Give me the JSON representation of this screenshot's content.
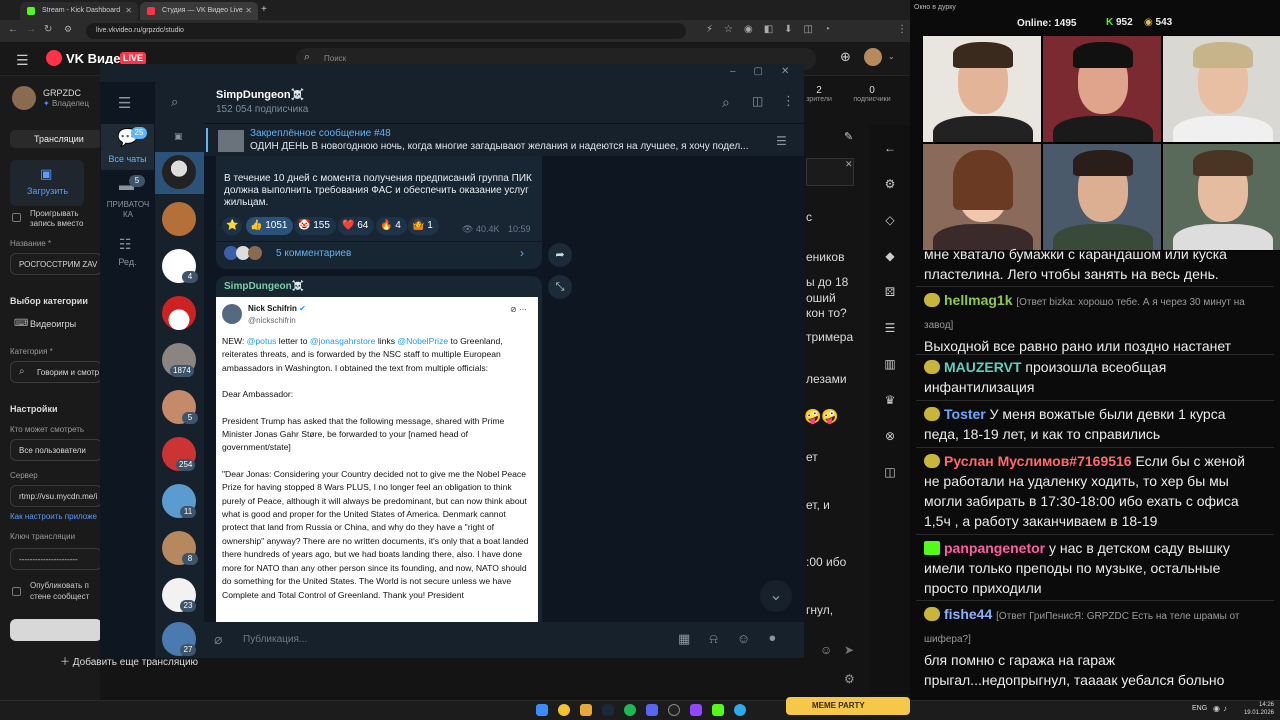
{
  "browser": {
    "tabs": [
      {
        "title": "Stream - Kick Dashboard"
      },
      {
        "title": "Студия — VK Видео Live"
      }
    ],
    "new_tab": "+",
    "url": "live.vkvideo.ru/grpzdc/studio"
  },
  "vk": {
    "logo": "VK Видео",
    "live_badge": "LIVE",
    "search_placeholder": "Поиск",
    "channel_name": "GRPZDC",
    "channel_role": "Владелец",
    "tab_streams": "Трансляции",
    "upload_label": "Загрузить",
    "play_in_cover": "Проигрывать запись вместо обложки",
    "name_label": "Название *",
    "name_value": "РОСГОССТРИМ ZAV",
    "category_title": "Выбор категории",
    "games_label": "Видеоигры",
    "category_label": "Категория *",
    "category_value": "Говорим и смотр",
    "settings_title": "Настройки",
    "who_can_watch_label": "Кто может смотреть",
    "who_can_watch_value": "Все пользователи",
    "server_label": "Сервер",
    "server_value": "rtmp://vsu.mycdn.me/i",
    "how_to_link": "Как настроить приложе",
    "key_label": "Ключ трансляции",
    "key_value": "----------------------",
    "publish_on_wall": "Опубликовать п стене сообщест",
    "add_stream": "Добавить еще трансляцию",
    "stats": [
      {
        "value": "2",
        "label": "зрители"
      },
      {
        "value": "0",
        "label": "подписчики"
      }
    ],
    "right_peeks": [
      "с",
      "еников",
      "ы до 18",
      "оший",
      "кон то?",
      "тримера",
      "лезами",
      "ет",
      "ет, и",
      ":00 ибо",
      "гнул,",
      "ть,"
    ]
  },
  "telegram": {
    "folders": [
      {
        "label": "Все чаты",
        "badge": "25"
      },
      {
        "label": "ПРИВАТОЧКА",
        "badge": "5"
      },
      {
        "label": "Ред."
      }
    ],
    "chat_badges": [
      "4",
      "1874",
      "5",
      "254",
      "11",
      "8",
      "23",
      "27"
    ],
    "channel_title": "SimpDungeon☠️",
    "subscribers": "152 054 подписчика",
    "pinned": {
      "title": "Закреплённое сообщение #48",
      "text": "ОДИН ДЕНЬ  В новогоднюю ночь, когда многие загадывают желания и надеются на лучшее, я хочу подел..."
    },
    "post1": {
      "text": "В течение 10 дней с момента получения предписаний группа ПИК должна выполнить требования ФАС и обеспечить оказание услуг жильцам.",
      "reactions": [
        {
          "emoji": "⭐",
          "count": ""
        },
        {
          "emoji": "👍",
          "count": "1051"
        },
        {
          "emoji": "🤡",
          "count": "155"
        },
        {
          "emoji": "❤️",
          "count": "64"
        },
        {
          "emoji": "🔥",
          "count": "4"
        },
        {
          "emoji": "🤷",
          "count": "1"
        }
      ],
      "views": "40.4K",
      "time": "10:59",
      "comments": "5 комментариев"
    },
    "post2": {
      "author": "SimpDungeon☠️",
      "tweet": {
        "name": "Nick Schifrin",
        "handle": "@nickschifrin",
        "p1_a": "NEW: ",
        "p1_m1": "@potus",
        "p1_b": " letter to ",
        "p1_m2": "@jonasgahrstore",
        "p1_c": " links ",
        "p1_m3": "@NobelPrize",
        "p1_d": " to Greenland, reiterates threats, and is forwarded by the NSC staff to multiple European ambassadors in Washington. I obtained the text from multiple officials:",
        "p2": "Dear Ambassador:",
        "p3": "President Trump has asked that the following message, shared with Prime Minister Jonas Gahr Støre, be forwarded to your [named head of government/state]",
        "p4": "\"Dear Jonas: Considering your Country decided not to give me the Nobel Peace Prize for having stopped 8 Wars PLUS, I no longer feel an obligation to think purely of Peace, although it will always be predominant, but can now think about what is good and proper for the United States of America. Denmark cannot protect that land from Russia or China, and why do they have a \"right of ownership\" anyway? There are no written documents, it's only that a boat landed there hundreds of years ago, but we had boats landing there, also. I have done more for NATO than any other person since its founding, and now, NATO should do something for the United States. The World is not secure unless we have Complete and Total Control of Greenland. Thank you! President"
      }
    },
    "input_placeholder": "Публикация..."
  },
  "kick": {
    "window_title": "Окно в дурку",
    "online_label": "Online:",
    "online_value": "1495",
    "stat_a": "952",
    "stat_b": "543",
    "messages": [
      {
        "user": "",
        "reply": "",
        "text": "мне хватало бумажки с карандашом или куска пластелина. Лего чтобы занять на весь день.",
        "color": "#ececec"
      },
      {
        "user": "hellmag1k",
        "reply": "[Ответ bizka: хорошо тебе. А я через 30 минут на завод]",
        "text": "Выходной все равно рано или поздно настанет",
        "color": "#8fc84a"
      },
      {
        "user": "MAUZERVT",
        "reply": "",
        "text": "произошла всеобщая инфантилизация",
        "color": "#5fd0c0"
      },
      {
        "user": "Toster",
        "reply": "",
        "text": "У меня вожатые были девки 1 курса педа, 18-19 лет, и как то справились",
        "color": "#6ea6ff"
      },
      {
        "user": "Руслан Муслимов#7169516",
        "reply": "",
        "text": "Если бы с женой не работали на удаленку ходить, то хер бы мы могли забирать в 17:30-18:00 ибо ехать с офиса 1,5ч , а работу заканчиваем в 18-19",
        "color": "#ff6b6b"
      },
      {
        "user": "panpangenetor",
        "reply": "",
        "text": "у нас в детском саду вышку имели только преподы по музыке, остальные просто приходили",
        "color": "#ff5fa2"
      },
      {
        "user": "fishe44",
        "reply": "[Ответ ГриПенисЯ: GRPZDC Есть на теле шрамы от шифера?]",
        "text": "бля помню с гаража на гараж прыгал...недопрыгнул, таааак уебался больно",
        "color": "#8fb0ff"
      }
    ]
  },
  "taskbar": {
    "meme_party": "MEME PARTY",
    "lang": "ENG",
    "time": "14:26",
    "date": "19.01.2026"
  }
}
